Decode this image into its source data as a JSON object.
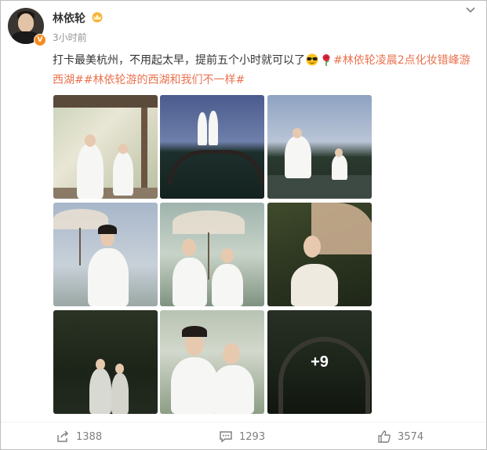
{
  "post": {
    "user": {
      "name": "林依轮",
      "verified_badge": "V",
      "crown_icon": "crown-icon"
    },
    "time": "3小时前",
    "text": "打卡最美杭州，不用起太早，提前五个小时就可以了",
    "emojis": [
      "sunglasses-emoji",
      "rose-emoji"
    ],
    "tags": [
      "#林依轮凌晨2点化妆错峰游西湖#",
      "#林依轮游的西湖和我们不一样#"
    ],
    "photos": [
      {
        "name": "pavilion-couple-photo"
      },
      {
        "name": "bridge-couple-photo"
      },
      {
        "name": "lakeside-couple-photo"
      },
      {
        "name": "umbrella-man-photo"
      },
      {
        "name": "umbrella-couple-photo"
      },
      {
        "name": "umbrella-woman-photo"
      },
      {
        "name": "forest-couple-photo"
      },
      {
        "name": "smiling-couple-photo"
      },
      {
        "name": "stone-bridge-photo"
      }
    ],
    "more_photos": "+9"
  },
  "footer": {
    "share_count": "1388",
    "comment_count": "1293",
    "like_count": "3574"
  },
  "colors": {
    "tag": "#eb7350",
    "badge": "#f78b1f",
    "muted": "#939393"
  }
}
